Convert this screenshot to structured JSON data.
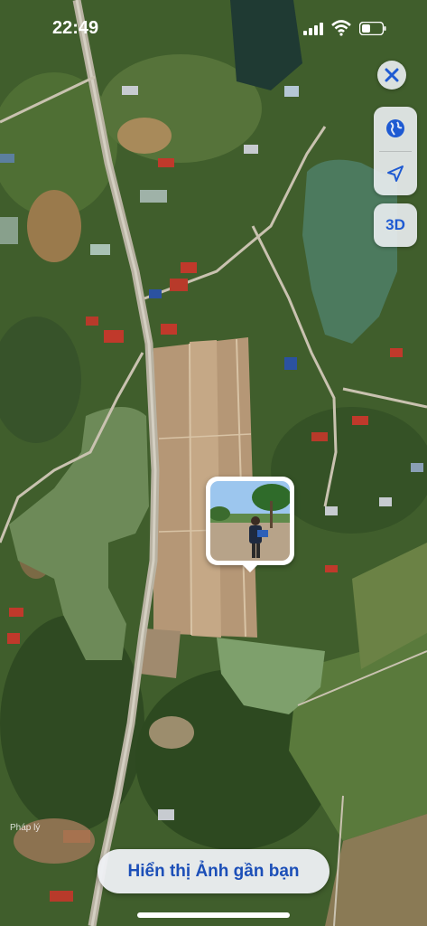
{
  "status_bar": {
    "time": "22:49"
  },
  "controls": {
    "three_d_label": "3D"
  },
  "map": {
    "legal_label": "Pháp lý"
  },
  "bottom_button": {
    "label": "Hiển thị Ảnh gần bạn"
  },
  "colors": {
    "accent": "#1c4fb8",
    "control_bg": "#ebeef2"
  }
}
